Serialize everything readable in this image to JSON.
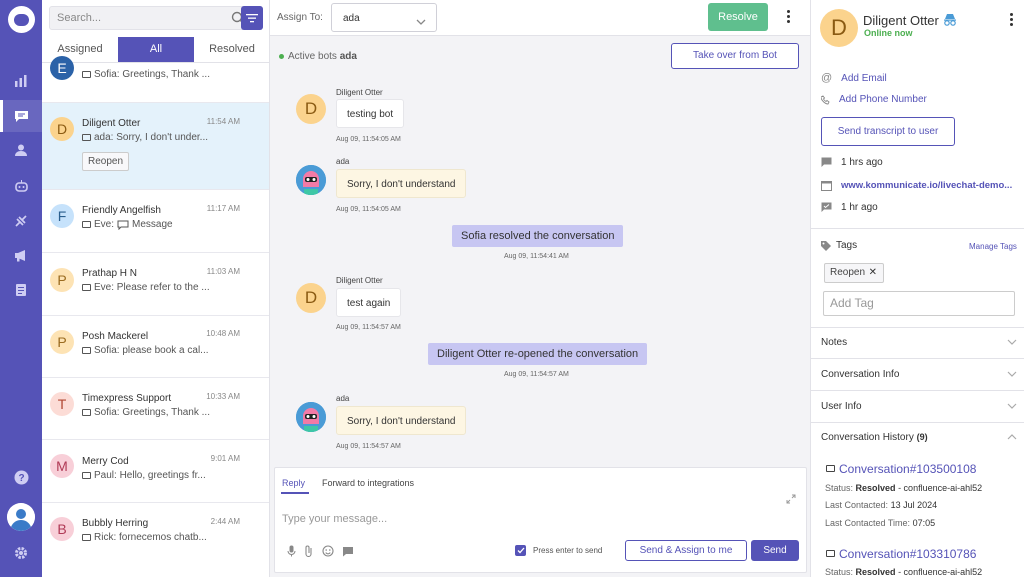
{
  "sidebar": {
    "icons": [
      "logo-icon",
      "reports-icon",
      "conversations-icon",
      "contacts-icon",
      "bot-icon",
      "integrations-icon",
      "campaigns-icon",
      "articles-icon",
      "help-icon",
      "user-avatar",
      "settings-icon"
    ]
  },
  "conversation_list": {
    "search_placeholder": "Search...",
    "tabs": [
      "Assigned",
      "All",
      "Resolved"
    ],
    "active_tab": "All",
    "items": [
      {
        "initial": "E",
        "name": "",
        "time": "",
        "preview": "Sofia: Greetings, Thank ...",
        "avatar_bg": "#2b62a8",
        "avatar_fg": "#ffffff"
      },
      {
        "initial": "D",
        "name": "Diligent Otter",
        "time": "11:54 AM",
        "preview": "ada: Sorry, I don't under...",
        "avatar_bg": "#fbd38d",
        "avatar_fg": "#8a5a12",
        "action": "Reopen"
      },
      {
        "initial": "F",
        "name": "Friendly Angelfish",
        "time": "11:17 AM",
        "preview": "Eve:",
        "preview_extra": "Message",
        "avatar_bg": "#c6e2fb",
        "avatar_fg": "#2a5f8e"
      },
      {
        "initial": "P",
        "name": "Prathap H N",
        "time": "11:03 AM",
        "preview": "Eve: Please refer to the ...",
        "avatar_bg": "#fde3b4",
        "avatar_fg": "#9a6b1f"
      },
      {
        "initial": "P",
        "name": "Posh Mackerel",
        "time": "10:48 AM",
        "preview": "Sofia: please book a cal...",
        "avatar_bg": "#fde3b4",
        "avatar_fg": "#9a6b1f"
      },
      {
        "initial": "T",
        "name": "Timexpress Support",
        "time": "10:33 AM",
        "preview": "Sofia: Greetings, Thank ...",
        "avatar_bg": "#fcdcd6",
        "avatar_fg": "#b04632"
      },
      {
        "initial": "M",
        "name": "Merry Cod",
        "time": "9:01 AM",
        "preview": "Paul: Hello, greetings fr...",
        "avatar_bg": "#f8cfd8",
        "avatar_fg": "#b03a56"
      },
      {
        "initial": "B",
        "name": "Bubbly Herring",
        "time": "2:44 AM",
        "preview": "Rick: fornecemos chatb...",
        "avatar_bg": "#f8cfd8",
        "avatar_fg": "#b03a56"
      }
    ]
  },
  "header": {
    "assign_label": "Assign To:",
    "assign_value": "ada",
    "resolve_label": "Resolve",
    "active_bots_label": "Active bots",
    "active_bots_value": "ada",
    "takeover_label": "Take over from Bot"
  },
  "messages": [
    {
      "type": "user",
      "sender": "Diligent Otter",
      "text": "testing bot",
      "time": "Aug 09, 11:54:05 AM"
    },
    {
      "type": "bot",
      "sender": "ada",
      "text": "Sorry, I don't understand",
      "time": "Aug 09, 11:54:05 AM"
    },
    {
      "type": "system",
      "text": "Sofia resolved the conversation",
      "time": "Aug 09, 11:54:41 AM"
    },
    {
      "type": "user",
      "sender": "Diligent Otter",
      "text": "test again",
      "time": "Aug 09, 11:54:57 AM"
    },
    {
      "type": "system",
      "text": "Diligent Otter re-opened the conversation",
      "time": "Aug 09, 11:54:57 AM"
    },
    {
      "type": "bot",
      "sender": "ada",
      "text": "Sorry, I don't understand",
      "time": "Aug 09, 11:54:57 AM"
    }
  ],
  "composer": {
    "tabs": [
      "Reply",
      "Forward to integrations"
    ],
    "active_tab": "Reply",
    "placeholder": "Type your message...",
    "press_enter_label": "Press enter to send",
    "press_enter_checked": true,
    "send_assign_label": "Send & Assign to me",
    "send_label": "Send"
  },
  "profile": {
    "initial": "D",
    "name": "Diligent Otter",
    "status": "Online now",
    "add_email": "Add Email",
    "add_phone": "Add Phone Number",
    "transcript_label": "Send transcript to user",
    "last_seen": "1 hrs ago",
    "page_url": "www.kommunicate.io/livechat-demo...",
    "last_message": "1 hr ago",
    "tags_title": "Tags",
    "manage_tags": "Manage Tags",
    "tags": [
      "Reopen"
    ],
    "add_tag_placeholder": "Add Tag",
    "sections": [
      "Notes",
      "Conversation Info",
      "User Info"
    ],
    "history_title": "Conversation History",
    "history_count": "(9)",
    "history": [
      {
        "id": "Conversation#103500108",
        "status_label": "Status:",
        "status": "Resolved",
        "source": " - confluence-ai-ahl52",
        "contacted_label": "Last Contacted:",
        "contacted": "13 Jul 2024",
        "time_label": "Last Contacted Time:",
        "time": "07:05"
      },
      {
        "id": "Conversation#103310786",
        "status_label": "Status:",
        "status": "Resolved",
        "source": " - confluence-ai-ahl52"
      }
    ]
  },
  "colors": {
    "primary": "#5553b7",
    "resolve": "#5fbf8e",
    "online": "#4caf50",
    "system_msg": "#c7c6f2",
    "bot_bubble": "#fdf6e3"
  }
}
